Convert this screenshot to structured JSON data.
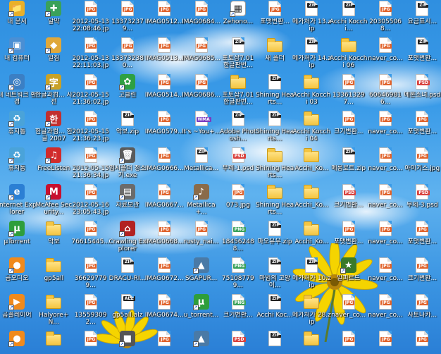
{
  "desktop": {
    "icons": [
      {
        "label": "내 문서",
        "kind": "app",
        "icon": "my-documents-icon",
        "color": "#e9b02a"
      },
      {
        "label": "알약",
        "kind": "app",
        "icon": "alyac-icon",
        "color": "#3aa15a"
      },
      {
        "label": "2012-05-13 22:08:46.jpg",
        "kind": "file",
        "tag": "JPG"
      },
      {
        "label": "133732379...",
        "kind": "file",
        "tag": "JPG"
      },
      {
        "label": "IMAG0512...",
        "kind": "file",
        "tag": "JPG"
      },
      {
        "label": "IMAG0684...",
        "kind": "file",
        "tag": "JPG"
      },
      {
        "label": "Zehono...",
        "kind": "app",
        "icon": "document-icon",
        "color": "#ffffff"
      },
      {
        "label": "포맷변환...",
        "kind": "file",
        "tag": "JPG"
      },
      {
        "label": "메가처가 13.zip",
        "kind": "file",
        "tag": "ZIP"
      },
      {
        "label": "Acchi Kocchi...",
        "kind": "file",
        "tag": "ZIP"
      },
      {
        "label": "203055068...",
        "kind": "file",
        "tag": "JPG"
      },
      {
        "label": "요금표시...",
        "kind": "file",
        "tag": "ZIP"
      },
      {
        "label": "내 컴퓨터",
        "kind": "app",
        "icon": "my-computer-icon",
        "color": "#4a8fd4"
      },
      {
        "label": "알집",
        "kind": "app",
        "icon": "alzip-icon",
        "color": "#e0a83a"
      },
      {
        "label": "2012-05-13 22:11:03.jpg",
        "kind": "file",
        "tag": "JPG"
      },
      {
        "label": "133732380...",
        "kind": "file",
        "tag": "JPG"
      },
      {
        "label": "IMAG0513...",
        "kind": "file",
        "tag": "JPG"
      },
      {
        "label": "IMAG0685...",
        "kind": "file",
        "tag": "JPG"
      },
      {
        "label": "포토샵7.01 한글판번...",
        "kind": "file",
        "tag": "ZIP"
      },
      {
        "label": "새 폴더",
        "kind": "folder"
      },
      {
        "label": "메가처가 14.zip",
        "kind": "file",
        "tag": "ZIP"
      },
      {
        "label": "Acchi Kocchi 06",
        "kind": "folder"
      },
      {
        "label": "naver_co...",
        "kind": "file",
        "tag": "JPG"
      },
      {
        "label": "포맷변환...",
        "kind": "file",
        "tag": "ZIP"
      },
      {
        "label": "내 네트워크 환경",
        "kind": "app",
        "icon": "network-icon",
        "color": "#3b7fc4"
      },
      {
        "label": "한글과컴... 사전",
        "kind": "app",
        "icon": "hancom-dict-icon",
        "color": "#c9a227"
      },
      {
        "label": "2012-05-15 21:36:02.jpg",
        "kind": "file",
        "tag": "JPG"
      },
      {
        "label": "고클린",
        "kind": "app",
        "icon": "goclean-icon",
        "color": "#2ea043"
      },
      {
        "label": "IMAG0514...",
        "kind": "file",
        "tag": "JPG"
      },
      {
        "label": "IMAG0686...",
        "kind": "file",
        "tag": "JPG"
      },
      {
        "label": "포토샵7.01 한글판번...",
        "kind": "folder"
      },
      {
        "label": "Shining Hearts...",
        "kind": "file",
        "tag": "ZIP"
      },
      {
        "label": "Acchi Kocchi 03",
        "kind": "folder"
      },
      {
        "label": "133613297...",
        "kind": "file",
        "tag": "JPG"
      },
      {
        "label": "606469816...",
        "kind": "file",
        "tag": "JPG"
      },
      {
        "label": "메론소녀.psd",
        "kind": "file",
        "tag": "PSD"
      },
      {
        "label": "휴지통",
        "kind": "app",
        "icon": "recycle-bin-icon",
        "color": "#4aa3d9"
      },
      {
        "label": "한글과컴... 한글 2007",
        "kind": "app",
        "icon": "hangul-icon",
        "color": "#c22f2f"
      },
      {
        "label": "2012-05-15 21:36:23.jpg",
        "kind": "file",
        "tag": "JPG"
      },
      {
        "label": "악보.zip",
        "kind": "file",
        "tag": "ZIP"
      },
      {
        "label": "IMAG0579...",
        "kind": "file",
        "tag": "JPG"
      },
      {
        "label": "It's ~You+...",
        "kind": "file",
        "tag": "WMA"
      },
      {
        "label": "Adobe Photosh...",
        "kind": "file",
        "tag": "ZIP"
      },
      {
        "label": "Shining Hearts...",
        "kind": "file",
        "tag": "ZIP"
      },
      {
        "label": "Acchi Kocchi 04",
        "kind": "folder"
      },
      {
        "label": "크기변환...",
        "kind": "file",
        "tag": "JPG"
      },
      {
        "label": "naver_co...",
        "kind": "file",
        "tag": "JPG"
      },
      {
        "label": "포맷변환...",
        "kind": "file",
        "tag": "JPG"
      },
      {
        "label": "휴지통",
        "kind": "app",
        "icon": "recycle-bin-icon",
        "color": "#4aa3d9"
      },
      {
        "label": "FreeListen",
        "kind": "app",
        "icon": "freelisten-icon",
        "color": "#d12b2b"
      },
      {
        "label": "2012-05-15 21:36:34.jpg",
        "kind": "file",
        "tag": "JPG"
      },
      {
        "label": "임시폴더 청소기.exe",
        "kind": "app",
        "icon": "trash-cleaner-icon",
        "color": "#5b5b5b"
      },
      {
        "label": "IMAG0666...",
        "kind": "file",
        "tag": "JPG"
      },
      {
        "label": "Metallica...",
        "kind": "file",
        "tag": "ZIP"
      },
      {
        "label": "무제-1.psd",
        "kind": "file",
        "tag": "PSD"
      },
      {
        "label": "Shining Hearts...",
        "kind": "folder"
      },
      {
        "label": "Acchi_Ko...",
        "kind": "folder"
      },
      {
        "label": "메롱로트.zip",
        "kind": "file",
        "tag": "ZIP"
      },
      {
        "label": "naver_co...",
        "kind": "file",
        "tag": "JPG"
      },
      {
        "label": "아이기스.jpg",
        "kind": "file",
        "tag": "JPG"
      },
      {
        "label": "Internet Explorer",
        "kind": "app",
        "icon": "internet-explorer-icon",
        "color": "#2b7fd4"
      },
      {
        "label": "McAfee Security...",
        "kind": "app",
        "icon": "mcafee-icon",
        "color": "#c8102e"
      },
      {
        "label": "2012-05-16 23:05:43.jpg",
        "kind": "file",
        "tag": "JPG"
      },
      {
        "label": "자료보관",
        "kind": "app",
        "icon": "archive-icon",
        "color": "#6b6b6b"
      },
      {
        "label": "IMAG0667...",
        "kind": "file",
        "tag": "JPG"
      },
      {
        "label": "Metallica+...",
        "kind": "app",
        "icon": "music-icon",
        "color": "#8a6b4a"
      },
      {
        "label": "073.jpg",
        "kind": "file",
        "tag": "JPG"
      },
      {
        "label": "Shining Hearts...",
        "kind": "folder"
      },
      {
        "label": "Acchi_Ko...",
        "kind": "folder"
      },
      {
        "label": "크기변환...",
        "kind": "file",
        "tag": "PSD"
      },
      {
        "label": "naver_co...",
        "kind": "file",
        "tag": "JPG"
      },
      {
        "label": "무제-3.psd",
        "kind": "file",
        "tag": "PSD"
      },
      {
        "label": "µTorrent",
        "kind": "app",
        "icon": "utorrent-icon",
        "color": "#2e9e3b"
      },
      {
        "label": "악보",
        "kind": "folder"
      },
      {
        "label": "76615445...",
        "kind": "file",
        "tag": "JPG"
      },
      {
        "label": "Crawling Explorer",
        "kind": "app",
        "icon": "crawling-explorer-icon",
        "color": "#b22222"
      },
      {
        "label": "IMAG0668...",
        "kind": "file",
        "tag": "JPG"
      },
      {
        "label": "rusty_nai...",
        "kind": "file",
        "tag": "JPG"
      },
      {
        "label": "184562488...",
        "kind": "file",
        "tag": "PNG"
      },
      {
        "label": "마오유우.zip",
        "kind": "file",
        "tag": "ZIP"
      },
      {
        "label": "Acchi_Ko...",
        "kind": "folder"
      },
      {
        "label": "포맷변환...",
        "kind": "file",
        "tag": "JPG"
      },
      {
        "label": "naver_co...",
        "kind": "file",
        "tag": "JPG"
      },
      {
        "label": "포맷변환...",
        "kind": "file",
        "tag": "JPG"
      },
      {
        "label": "곰오디오",
        "kind": "app",
        "icon": "gom-audio-icon",
        "color": "#f08a1c"
      },
      {
        "label": "gp5all",
        "kind": "folder"
      },
      {
        "label": "366297799...",
        "kind": "file",
        "tag": "JPG"
      },
      {
        "label": "DRACU-RI...",
        "kind": "file",
        "tag": "ZIP"
      },
      {
        "label": "IMAG0672...",
        "kind": "file",
        "tag": "JPG"
      },
      {
        "label": "SGAPUR...",
        "kind": "app",
        "icon": "mountain-image-icon",
        "color": "#4a7aa6"
      },
      {
        "label": "751087799...",
        "kind": "file",
        "tag": "PNG"
      },
      {
        "label": "마법의 고양이...",
        "kind": "file",
        "tag": "ZIP"
      },
      {
        "label": "메가처가 10.zip",
        "kind": "file",
        "tag": "ZIP"
      },
      {
        "label": "알피르드",
        "kind": "app",
        "icon": "game-icon",
        "color": "#3a7a2a"
      },
      {
        "label": "naver_co...",
        "kind": "file",
        "tag": "JPG"
      },
      {
        "label": "크기변환...",
        "kind": "file",
        "tag": "JPG"
      },
      {
        "label": "곰플레이어",
        "kind": "app",
        "icon": "gom-player-icon",
        "color": "#f08a1c"
      },
      {
        "label": "Halyore+N...",
        "kind": "folder"
      },
      {
        "label": "135593092...",
        "kind": "file",
        "tag": "JPG"
      },
      {
        "label": "gp5all.alz",
        "kind": "file",
        "tag": "ALZ"
      },
      {
        "label": "IMAG0674...",
        "kind": "file",
        "tag": "JPG"
      },
      {
        "label": "u_torrent...",
        "kind": "app",
        "icon": "utorrent-icon",
        "color": "#2e9e3b"
      },
      {
        "label": "크기변환...",
        "kind": "file",
        "tag": "PNG"
      },
      {
        "label": "Acchi Koc...",
        "kind": "file",
        "tag": "ZIP"
      },
      {
        "label": "메가처가 28.zip",
        "kind": "folder"
      },
      {
        "label": "naver_co...",
        "kind": "file",
        "tag": "JPG"
      },
      {
        "label": "naver_co...",
        "kind": "file",
        "tag": "JPG"
      },
      {
        "label": "사토나카...",
        "kind": "file",
        "tag": "JPG"
      },
      {
        "label": "",
        "kind": "app",
        "icon": "gom-icon",
        "color": "#f08a1c"
      },
      {
        "label": "",
        "kind": "folder"
      },
      {
        "label": "",
        "kind": "file",
        "tag": "JPG"
      },
      {
        "label": "",
        "kind": "app",
        "icon": "app-icon",
        "color": "#555555"
      },
      {
        "label": "",
        "kind": "file",
        "tag": "JPG"
      },
      {
        "label": "",
        "kind": "app",
        "icon": "mountain-image-icon",
        "color": "#4a7aa6"
      },
      {
        "label": "",
        "kind": "file",
        "tag": "PSD"
      },
      {
        "label": "",
        "kind": "file",
        "tag": "ZIP"
      },
      {
        "label": "",
        "kind": "folder"
      },
      {
        "label": "",
        "kind": "file",
        "tag": "JPG"
      },
      {
        "label": "",
        "kind": "file",
        "tag": "JPG"
      },
      {
        "label": "",
        "kind": "file",
        "tag": "JPG"
      }
    ]
  }
}
